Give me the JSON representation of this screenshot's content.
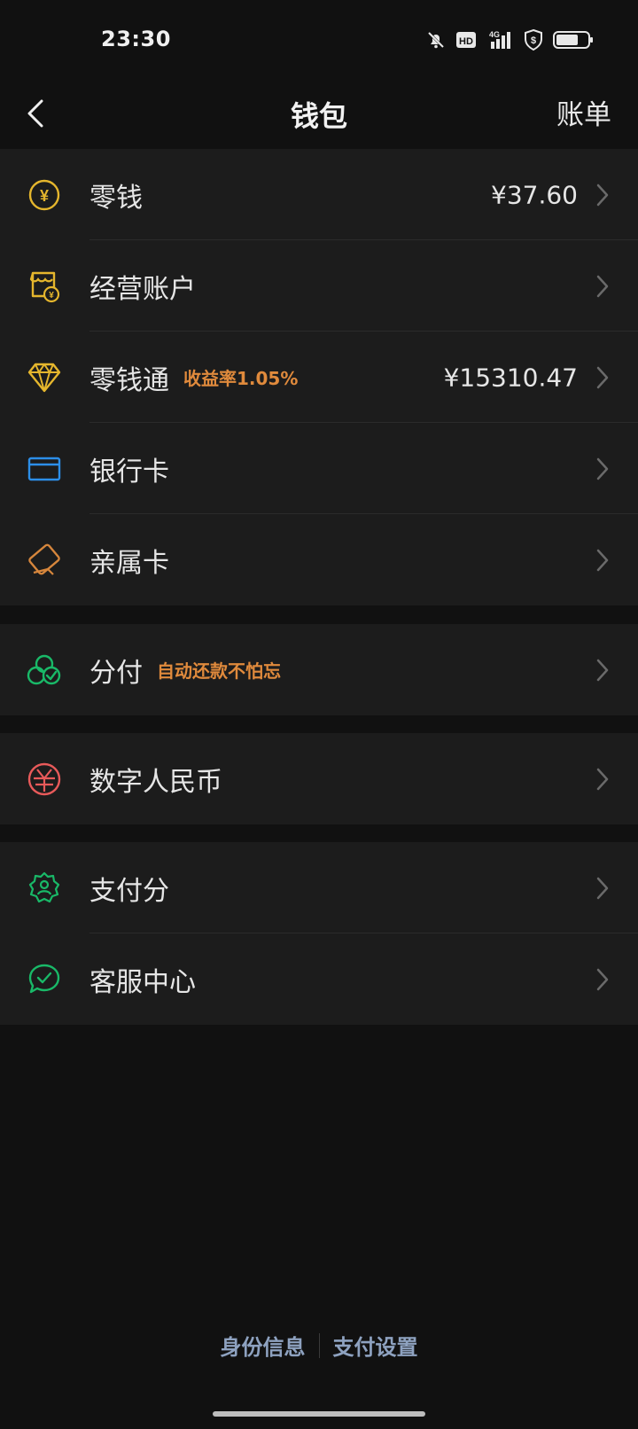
{
  "status_bar": {
    "time": "23:30",
    "icons": [
      "mute-bell-icon",
      "hd-icon",
      "signal-4g-icon",
      "vpn-shield-icon",
      "battery-icon"
    ],
    "hd_label": "HD",
    "network_label": "4G"
  },
  "header": {
    "back_icon": "chevron-left-icon",
    "title": "钱包",
    "bill_label": "账单"
  },
  "group1": {
    "items": [
      {
        "label": "零钱",
        "value": "¥37.60",
        "icon": "yuan-coin-icon"
      },
      {
        "label": "经营账户",
        "icon": "shop-account-icon"
      },
      {
        "label": "零钱通",
        "tag": "收益率1.05%",
        "value": "¥15310.47",
        "icon": "diamond-icon"
      },
      {
        "label": "银行卡",
        "icon": "bank-card-icon"
      },
      {
        "label": "亲属卡",
        "icon": "family-card-icon"
      }
    ]
  },
  "group2": {
    "items": [
      {
        "label": "分付",
        "tag": "自动还款不怕忘",
        "icon": "fenfu-icon"
      }
    ]
  },
  "group3": {
    "items": [
      {
        "label": "数字人民币",
        "icon": "digital-rmb-icon"
      }
    ]
  },
  "group4": {
    "items": [
      {
        "label": "支付分",
        "icon": "pay-score-badge-icon"
      },
      {
        "label": "客服中心",
        "icon": "customer-service-icon"
      }
    ]
  },
  "footer": {
    "identity_label": "身份信息",
    "pay_settings_label": "支付设置"
  },
  "colors": {
    "background": "#111111",
    "row_background": "#1c1c1c",
    "accent_orange": "#e08a3c",
    "footer_link": "#8ea2c0",
    "icon_yellow": "#e5b62d",
    "icon_blue": "#2c8ee8",
    "icon_orange": "#d6863c",
    "icon_green": "#19b968",
    "icon_red": "#e85a5a"
  }
}
